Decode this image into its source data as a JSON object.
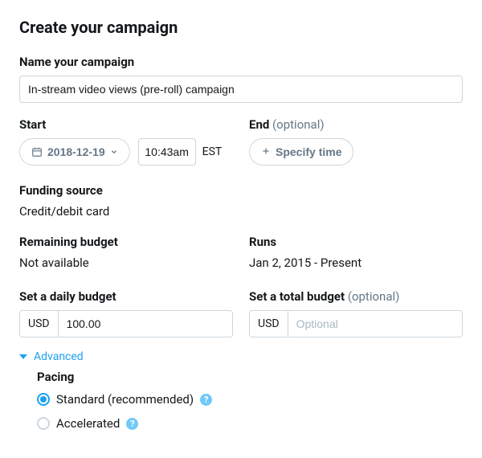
{
  "title": "Create your campaign",
  "name_section": {
    "label": "Name your campaign",
    "value": "In-stream video views (pre-roll) campaign"
  },
  "start": {
    "label": "Start",
    "date": "2018-12-19",
    "time": "10:43am",
    "tz": "EST"
  },
  "end": {
    "label": "End",
    "optional": "(optional)",
    "button": "Specify time"
  },
  "funding": {
    "label": "Funding source",
    "value": "Credit/debit card"
  },
  "remaining": {
    "label": "Remaining budget",
    "value": "Not available"
  },
  "runs": {
    "label": "Runs",
    "value": "Jan 2, 2015 - Present"
  },
  "daily": {
    "label": "Set a daily budget",
    "currency": "USD",
    "value": "100.00"
  },
  "total": {
    "label": "Set a total budget",
    "optional": "(optional)",
    "currency": "USD",
    "placeholder": "Optional"
  },
  "advanced": {
    "toggle": "Advanced",
    "pacing_label": "Pacing",
    "options": {
      "standard": "Standard (recommended)",
      "accelerated": "Accelerated"
    }
  }
}
